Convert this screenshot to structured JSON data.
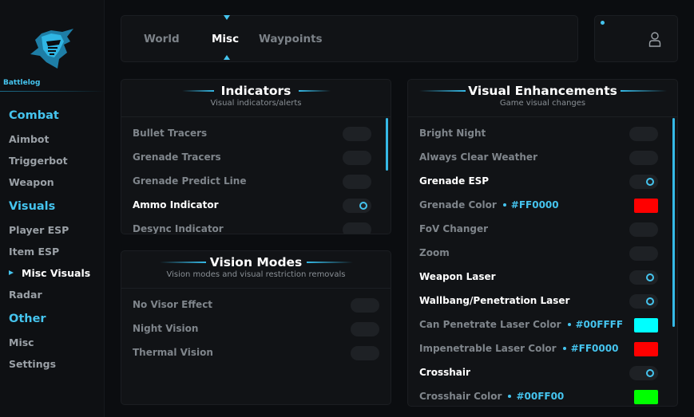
{
  "sidebar": {
    "brand": "Battlelog",
    "groups": [
      {
        "label": "Combat",
        "items": [
          "Aimbot",
          "Triggerbot",
          "Weapon"
        ]
      },
      {
        "label": "Visuals",
        "items": [
          "Player ESP",
          "Item ESP",
          "Misc Visuals",
          "Radar"
        ]
      },
      {
        "label": "Other",
        "items": [
          "Misc",
          "Settings"
        ]
      }
    ],
    "active_item": "Misc Visuals"
  },
  "tabs": {
    "items": [
      "World",
      "Misc",
      "Waypoints"
    ],
    "active": "Misc"
  },
  "panels": {
    "indicators": {
      "title": "Indicators",
      "subtitle": "Visual indicators/alerts",
      "rows": [
        {
          "label": "Bullet Tracers",
          "on": false
        },
        {
          "label": "Grenade Tracers",
          "on": false
        },
        {
          "label": "Grenade Predict Line",
          "on": false
        },
        {
          "label": "Ammo Indicator",
          "on": true
        },
        {
          "label": "Desync Indicator",
          "on": false
        }
      ]
    },
    "vision_modes": {
      "title": "Vision Modes",
      "subtitle": "Vision modes and visual restriction removals",
      "rows": [
        {
          "label": "No Visor Effect",
          "on": false
        },
        {
          "label": "Night Vision",
          "on": false
        },
        {
          "label": "Thermal Vision",
          "on": false
        }
      ]
    },
    "visual_enhancements": {
      "title": "Visual Enhancements",
      "subtitle": "Game visual changes",
      "rows": [
        {
          "label": "Bright Night",
          "type": "toggle",
          "on": false
        },
        {
          "label": "Always Clear Weather",
          "type": "toggle",
          "on": false
        },
        {
          "label": "Grenade ESP",
          "type": "toggle",
          "on": true
        },
        {
          "label": "Grenade Color",
          "type": "color",
          "hex": "#FF0000",
          "color": "#ff0000"
        },
        {
          "label": "FoV Changer",
          "type": "toggle",
          "on": false
        },
        {
          "label": "Zoom",
          "type": "toggle",
          "on": false
        },
        {
          "label": "Weapon Laser",
          "type": "toggle",
          "on": true
        },
        {
          "label": "Wallbang/Penetration Laser",
          "type": "toggle",
          "on": true
        },
        {
          "label": "Can Penetrate Laser Color",
          "type": "color",
          "hex": "#00FFFF",
          "color": "#00ffff"
        },
        {
          "label": "Impenetrable Laser Color",
          "type": "color",
          "hex": "#FF0000",
          "color": "#ff0000"
        },
        {
          "label": "Crosshair",
          "type": "toggle",
          "on": true
        },
        {
          "label": "Crosshair Color",
          "type": "color",
          "hex": "#00FF00",
          "color": "#00ff00"
        }
      ]
    }
  },
  "icons": {
    "logo": "knight-helmet-logo",
    "user": "user-icon",
    "status": "status-dot"
  },
  "colors": {
    "accent": "#45c4ee",
    "background": "#0b0d10",
    "panel": "#111316"
  }
}
